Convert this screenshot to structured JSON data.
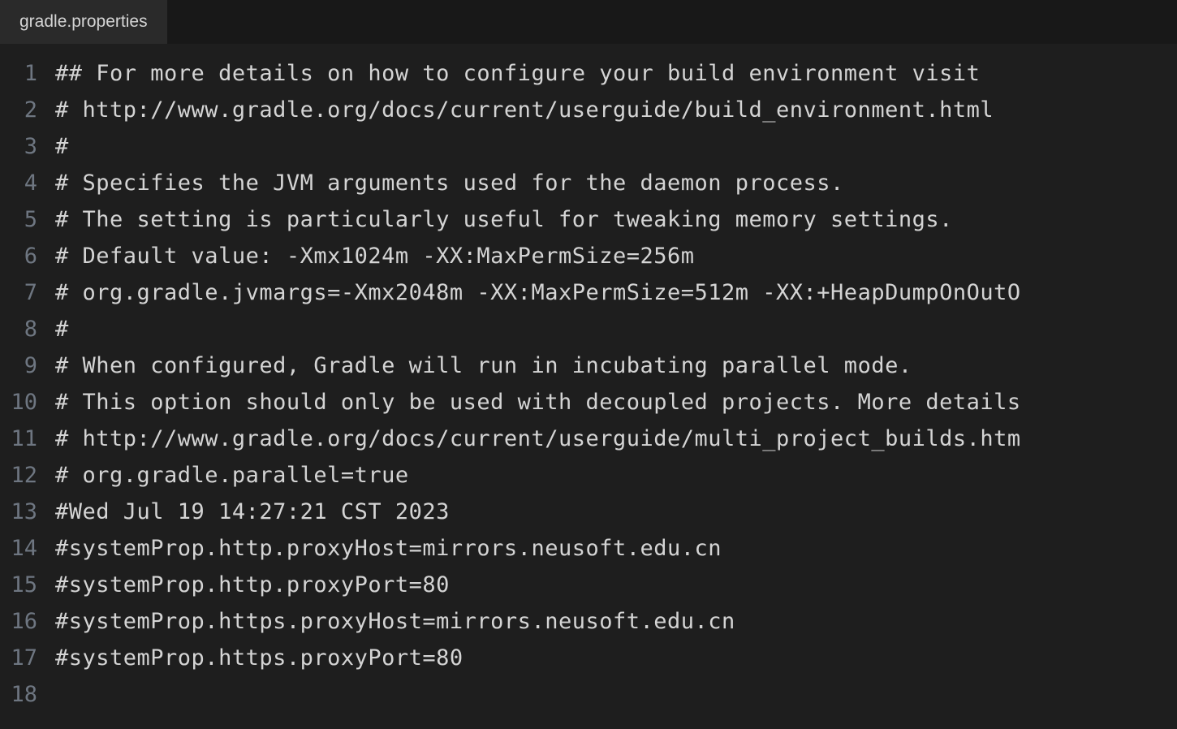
{
  "tab": {
    "filename": "gradle.properties"
  },
  "lines": [
    {
      "num": "1",
      "text": "## For more details on how to configure your build environment visit"
    },
    {
      "num": "2",
      "text": "# http://www.gradle.org/docs/current/userguide/build_environment.html"
    },
    {
      "num": "3",
      "text": "#"
    },
    {
      "num": "4",
      "text": "# Specifies the JVM arguments used for the daemon process."
    },
    {
      "num": "5",
      "text": "# The setting is particularly useful for tweaking memory settings."
    },
    {
      "num": "6",
      "text": "# Default value: -Xmx1024m -XX:MaxPermSize=256m"
    },
    {
      "num": "7",
      "text": "# org.gradle.jvmargs=-Xmx2048m -XX:MaxPermSize=512m -XX:+HeapDumpOnOutO"
    },
    {
      "num": "8",
      "text": "#"
    },
    {
      "num": "9",
      "text": "# When configured, Gradle will run in incubating parallel mode."
    },
    {
      "num": "10",
      "text": "# This option should only be used with decoupled projects. More details"
    },
    {
      "num": "11",
      "text": "# http://www.gradle.org/docs/current/userguide/multi_project_builds.htm"
    },
    {
      "num": "12",
      "text": "# org.gradle.parallel=true"
    },
    {
      "num": "13",
      "text": "#Wed Jul 19 14:27:21 CST 2023"
    },
    {
      "num": "14",
      "text": "#systemProp.http.proxyHost=mirrors.neusoft.edu.cn"
    },
    {
      "num": "15",
      "text": "#systemProp.http.proxyPort=80"
    },
    {
      "num": "16",
      "text": "#systemProp.https.proxyHost=mirrors.neusoft.edu.cn"
    },
    {
      "num": "17",
      "text": "#systemProp.https.proxyPort=80"
    },
    {
      "num": "18",
      "text": ""
    }
  ],
  "highlighted_line": 18
}
